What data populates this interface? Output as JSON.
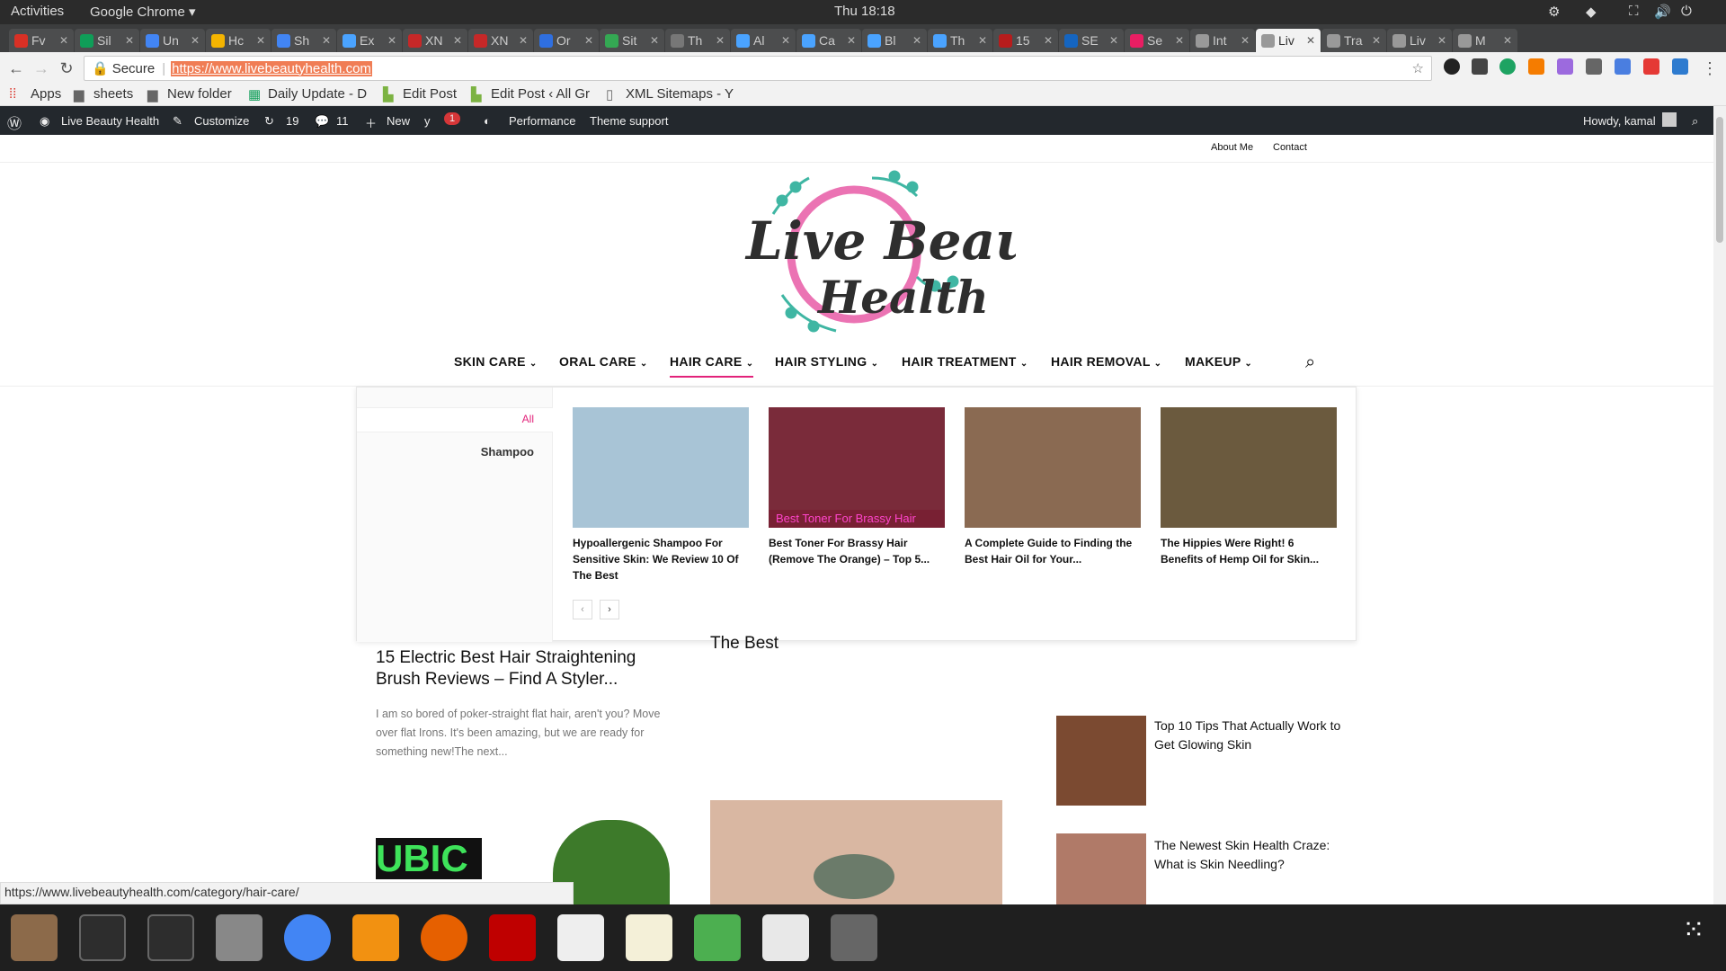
{
  "gnome": {
    "activities": "Activities",
    "app": "Google Chrome ▾",
    "clock": "Thu 18:18"
  },
  "tabs": [
    {
      "label": "Fv",
      "color": "#d93025",
      "active": false
    },
    {
      "label": "Sil",
      "color": "#0f9d58",
      "active": false
    },
    {
      "label": "Un",
      "color": "#4285f4",
      "active": false
    },
    {
      "label": "Hc",
      "color": "#f4b400",
      "active": false
    },
    {
      "label": "Sh",
      "color": "#4285f4",
      "active": false
    },
    {
      "label": "Ex",
      "color": "#4aa3ff",
      "active": false
    },
    {
      "label": "XN",
      "color": "#c62828",
      "active": false
    },
    {
      "label": "XN",
      "color": "#c62828",
      "active": false
    },
    {
      "label": "Or",
      "color": "#2f6fe0",
      "active": false
    },
    {
      "label": "Sit",
      "color": "#34a853",
      "active": false
    },
    {
      "label": "Th",
      "color": "#777",
      "active": false
    },
    {
      "label": "Al",
      "color": "#4aa3ff",
      "active": false
    },
    {
      "label": "Ca",
      "color": "#4aa3ff",
      "active": false
    },
    {
      "label": "Bl",
      "color": "#4aa3ff",
      "active": false
    },
    {
      "label": "Th",
      "color": "#4aa3ff",
      "active": false
    },
    {
      "label": "15",
      "color": "#b71c1c",
      "active": false
    },
    {
      "label": "SE",
      "color": "#1565c0",
      "active": false
    },
    {
      "label": "Se",
      "color": "#e91e63",
      "active": false
    },
    {
      "label": "Int",
      "color": "#999",
      "active": false
    },
    {
      "label": "Liv",
      "color": "#999",
      "active": true
    },
    {
      "label": "Tra",
      "color": "#999",
      "active": false
    },
    {
      "label": "Liv",
      "color": "#999",
      "active": false
    },
    {
      "label": "M",
      "color": "#999",
      "active": false
    }
  ],
  "address": {
    "secure": "Secure",
    "url": "https://www.livebeautyhealth.com"
  },
  "bookmarks": {
    "apps": "Apps",
    "b1": "sheets",
    "b2": "New folder",
    "b3": "Daily Update - D",
    "b4": "Edit Post",
    "b5": "Edit Post ‹ All Gr",
    "b6": "XML Sitemaps - Y"
  },
  "wp": {
    "site": "Live Beauty Health",
    "customize": "Customize",
    "updates": "19",
    "comments": "11",
    "new": "New",
    "yoast_count": "1",
    "performance": "Performance",
    "theme_support": "Theme support",
    "howdy": "Howdy, kamal"
  },
  "top_links": {
    "about": "About Me",
    "contact": "Contact"
  },
  "logo": {
    "line1": "Live Beauty",
    "line2": "Health"
  },
  "menu": [
    {
      "label": "SKIN CARE",
      "active": false
    },
    {
      "label": "ORAL CARE",
      "active": false
    },
    {
      "label": "HAIR CARE",
      "active": true
    },
    {
      "label": "HAIR STYLING",
      "active": false
    },
    {
      "label": "HAIR TREATMENT",
      "active": false
    },
    {
      "label": "HAIR REMOVAL",
      "active": false
    },
    {
      "label": "MAKEUP",
      "active": false
    }
  ],
  "mega": {
    "side_all": "All",
    "side_shampoo": "Shampoo",
    "cards": [
      {
        "title": "Hypoallergenic Shampoo For Sensitive Skin: We Review 10 Of The Best",
        "img": "#a8c4d6"
      },
      {
        "title": "Best Toner For Brassy Hair (Remove The Orange) – Top 5...",
        "img": "#7a2b3a",
        "overlay": "Best Toner For Brassy Hair"
      },
      {
        "title": "A Complete Guide to Finding the Best Hair Oil for Your...",
        "img": "#8a6a52"
      },
      {
        "title": "The Hippies Were Right! 6 Benefits of Hemp Oil for Skin...",
        "img": "#6b5a3e"
      }
    ]
  },
  "articles": {
    "a1_title": "15 Electric Best Hair Straightening Brush Reviews – Find A Styler...",
    "a1_excerpt": "I am so bored of poker-straight flat hair, aren't you? Move over flat Irons. It's been amazing, but we are ready for something new!The next...",
    "a2_title_tail": "The Best",
    "s1": "Top 10 Tips That Actually Work to Get Glowing Skin",
    "s2": "The Newest Skin Health Craze: What is Skin Needling?",
    "bottom_tag": "UBIC"
  },
  "status_url": "https://www.livebeautyhealth.com/category/hair-care/"
}
